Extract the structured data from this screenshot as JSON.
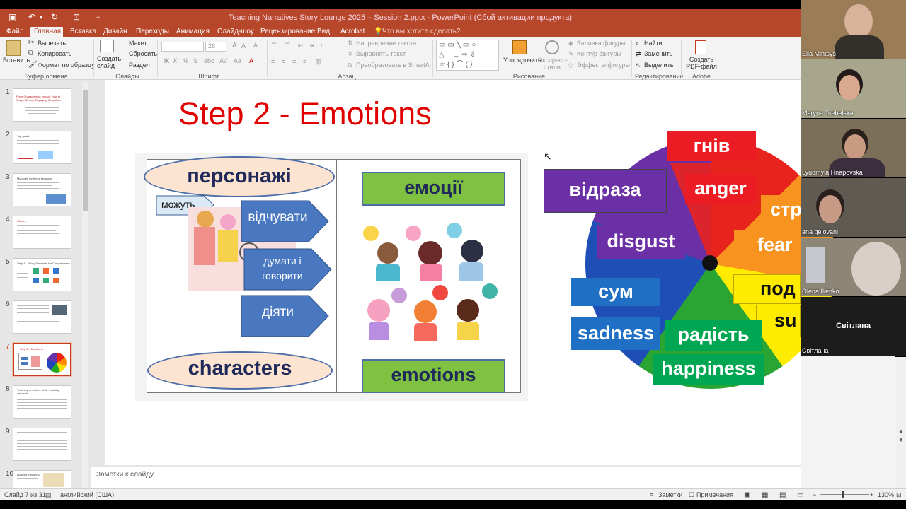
{
  "window": {
    "title": "Teaching Narratives Story Lounge 2025 – Session 2.pptx - PowerPoint (Сбой активации продукта)"
  },
  "tabs": [
    "Файл",
    "Главная",
    "Вставка",
    "Дизайн",
    "Переходы",
    "Анимация",
    "Слайд-шоу",
    "Рецензирование",
    "Вид",
    "Acrobat"
  ],
  "tell_me": "Что вы хотите сделать?",
  "ribbon": {
    "paste": "Вставить",
    "cut": "Вырезать",
    "copy": "Копировать",
    "format_painter": "Формат по образцу",
    "clipboard_group": "Буфер обмена",
    "new_slide": "Создать слайд",
    "layout": "Макет",
    "reset": "Сбросить",
    "section": "Раздел",
    "slides_group": "Слайды",
    "font_size": "28",
    "font_group": "Шрифт",
    "text_direction": "Направление текста",
    "align_text": "Выровнять текст",
    "smartart": "Преобразовать в SmartArt",
    "paragraph_group": "Абзац",
    "arrange": "Упорядочить",
    "quick_styles": "Экспресс-стили",
    "shape_fill": "Заливка фигуры",
    "shape_outline": "Контур фигуры",
    "shape_effects": "Эффекты фигуры",
    "drawing_group": "Рисование",
    "find": "Найти",
    "replace": "Заменить",
    "select": "Выделить",
    "editing_group": "Редактирование",
    "create_pdf": "Создать PDF-файл",
    "acrobat_group": "Adobe Acrobat"
  },
  "thumbnails": [
    {
      "num": "1",
      "title": "From Characters to Impact: How to Shape Strong, Engaging Story Arcs"
    },
    {
      "num": "2",
      "title": "Top goals"
    },
    {
      "num": "3",
      "title": "My goals for these sessions"
    },
    {
      "num": "4",
      "title": "Stories"
    },
    {
      "num": "5",
      "title": "Step 1 – Story Elements for Comprehension"
    },
    {
      "num": "6",
      "title": ""
    },
    {
      "num": "7",
      "title": "Step 2 – Emotions"
    },
    {
      "num": "8",
      "title": "Teaching emotions while reaching mindsets"
    },
    {
      "num": "9",
      "title": ""
    },
    {
      "num": "10",
      "title": "Building emotions"
    }
  ],
  "slide": {
    "title": "Step 2 - Emotions",
    "persons": "персонажі",
    "can": "можуть",
    "feel": "відчувати",
    "think_say": "думати і говорити",
    "act": "діяти",
    "characters": "characters",
    "emotions_ua": "емоції",
    "emotions_en": "emotions",
    "wheel": {
      "anger_ua": "гнів",
      "anger_en": "anger",
      "disgust_ua": "відраза",
      "disgust_en": "disgust",
      "fear_ua": "стр",
      "fear_en": "fear",
      "surprise_ua": "под",
      "surprise_en": "su",
      "sadness_ua": "сум",
      "sadness_en": "sadness",
      "happiness_ua": "радість",
      "happiness_en": "happiness"
    }
  },
  "notes_placeholder": "Заметки к слайду",
  "status": {
    "slide_counter": "Слайд 7 из 31",
    "language": "английский (США)",
    "notes": "Заметки",
    "comments": "Примечания",
    "zoom": "130%"
  },
  "participants": [
    {
      "name": "Ella Mintsys"
    },
    {
      "name": "Maryna Tsehelska"
    },
    {
      "name": "Lyudmyla Hnapovska"
    },
    {
      "name": "ana gelovani"
    },
    {
      "name": "Olena Ilienko"
    },
    {
      "name": "Світлана",
      "display": "Світлана"
    }
  ]
}
